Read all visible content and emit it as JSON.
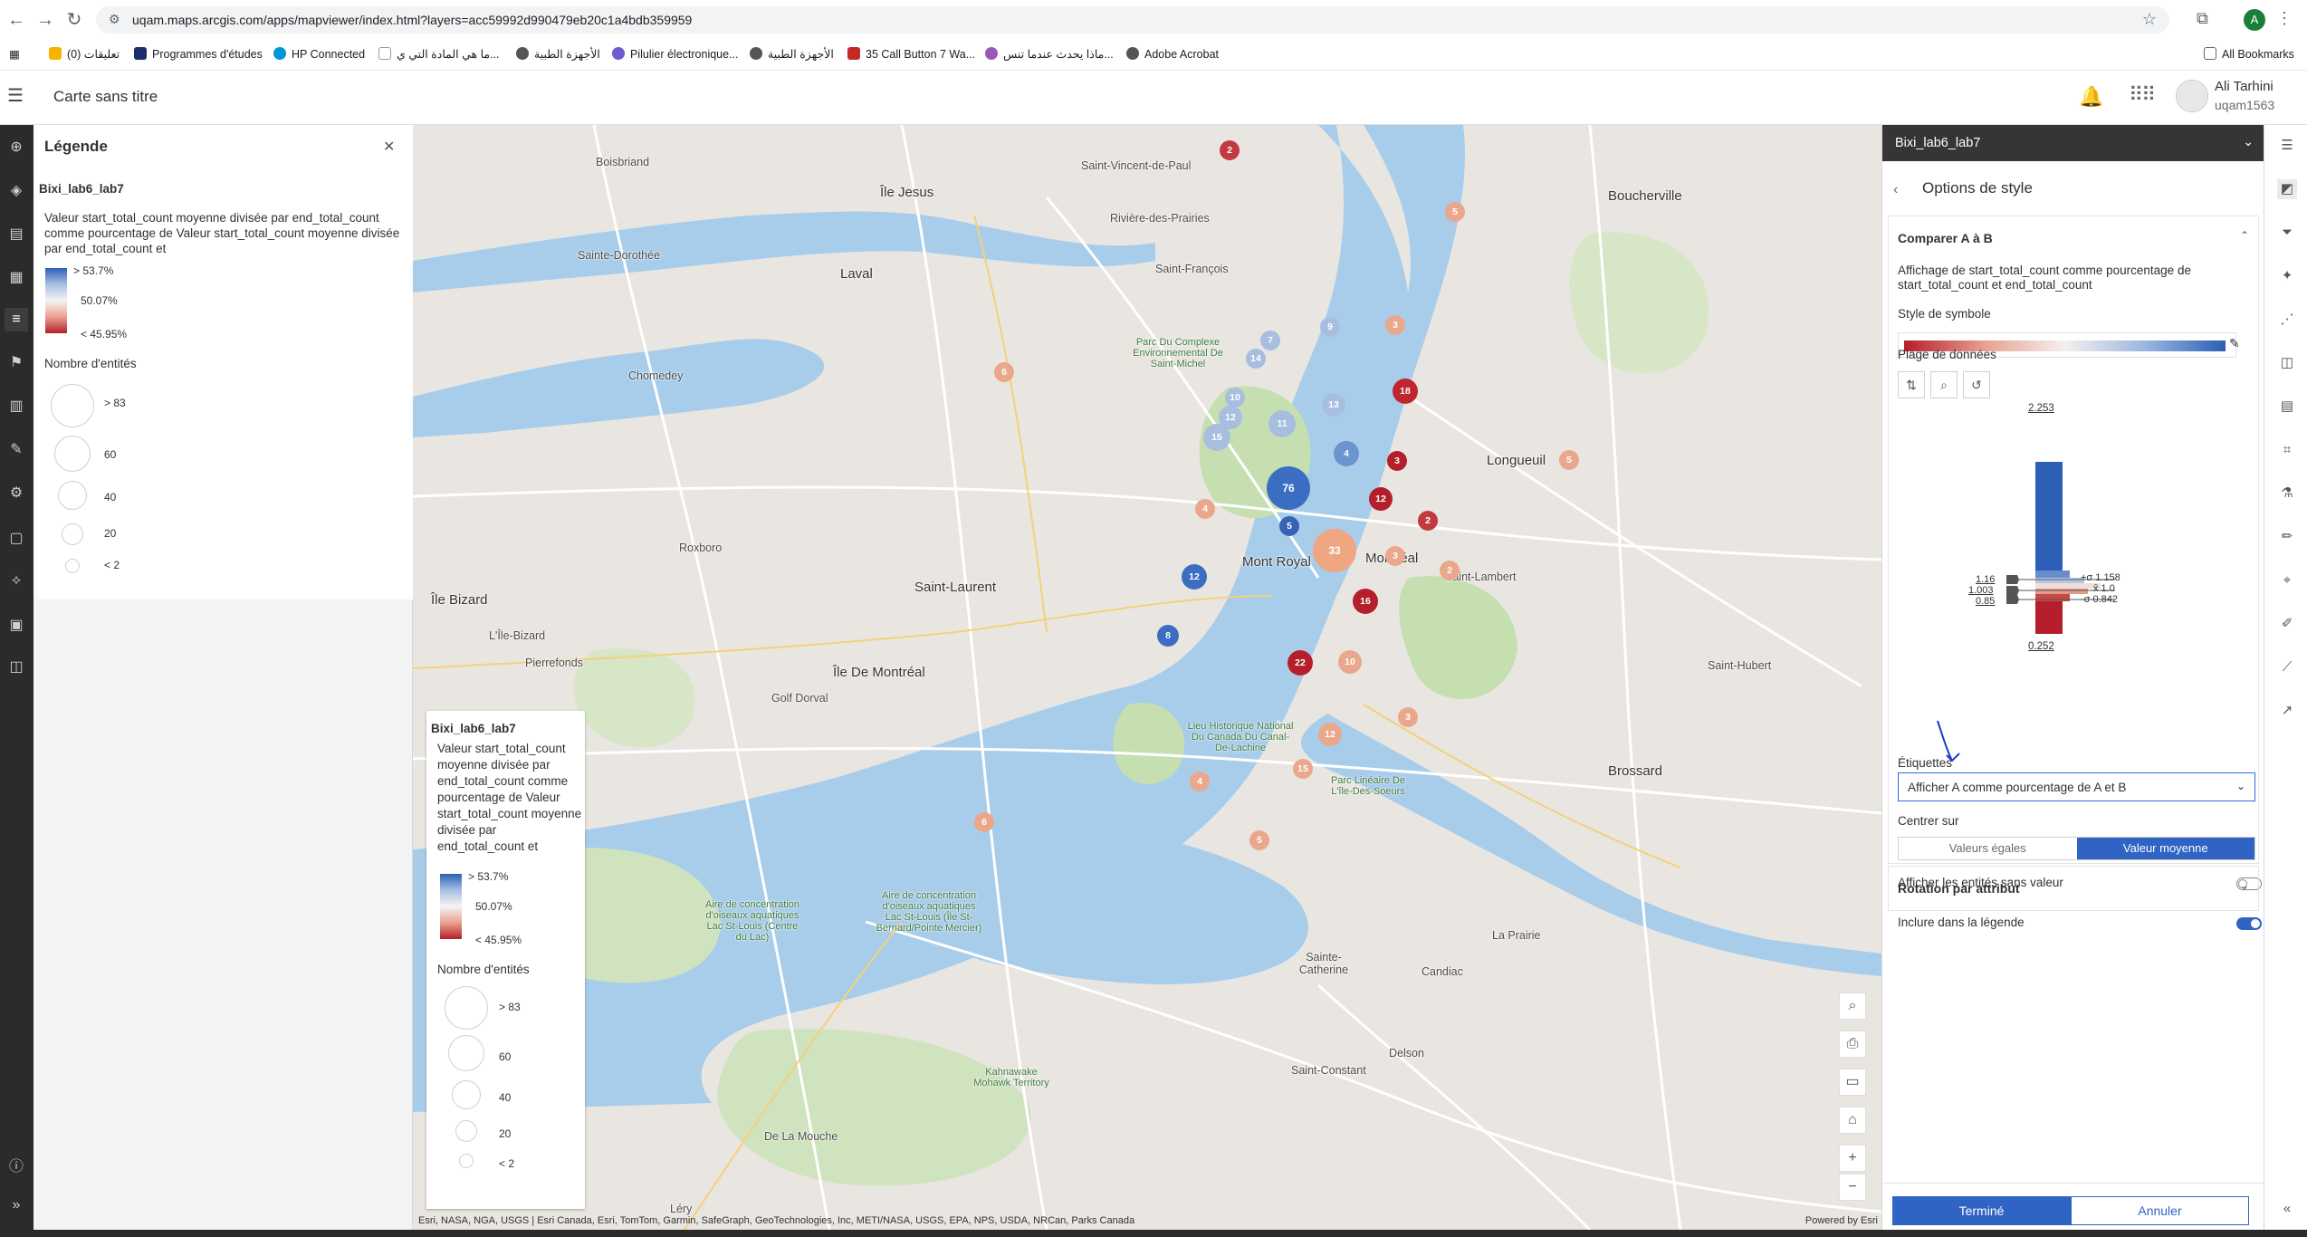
{
  "browser": {
    "url": "uqam.maps.arcgis.com/apps/mapviewer/index.html?layers=acc59992d990479eb20c1a4bdb359959",
    "profile_initial": "A",
    "bookmarks": [
      "تعليقات (0)",
      "Programmes d'études",
      "HP Connected",
      "ما هي المادة التي ي...",
      "الأجهزة الطبية",
      "Pilulier électronique...",
      "الأجهزة الطبية",
      "35 Call Button 7 Wa...",
      "ماذا يحدث عندما تنس...",
      "Adobe Acrobat"
    ],
    "all_bookmarks": "All Bookmarks"
  },
  "header": {
    "map_title": "Carte sans titre",
    "user_name": "Ali Tarhini",
    "user_id": "uqam1563"
  },
  "legend": {
    "title": "Légende",
    "layer_name": "Bixi_lab6_lab7",
    "description": "Valeur start_total_count moyenne divisée par end_total_count comme pourcentage de Valeur start_total_count moyenne divisée par end_total_count et",
    "ramp_labels": [
      "> 53.7%",
      "50.07%",
      "< 45.95%"
    ],
    "size_title": "Nombre d'entités",
    "size_labels": [
      "> 83",
      "60",
      "40",
      "20",
      "< 2"
    ]
  },
  "map": {
    "places": [
      "Boisbriand",
      "Île Jesus",
      "Laval",
      "Saint-Vincent-de-Paul",
      "Boucherville",
      "Sainte-Dorothée",
      "Saint-François",
      "Île Bizard",
      "Roxboro",
      "Saint-Laurent",
      "Pierrefonds",
      "L'Île-Bizard",
      "Longueuil",
      "Mont Royal",
      "Montréal",
      "Saint-Lambert",
      "Brossard",
      "La Prairie",
      "Candiac",
      "Delson",
      "Sainte-Catherine",
      "Saint-Constant",
      "Léry",
      "Chomedey",
      "Île De Montréal",
      "Golf Dorval",
      "Parc Du Complexe Environnemental De Saint-Michel",
      "Lieu Historique National Du Canada Du Canal-De-Lachine",
      "Parc Linéaire De L'île-Des-Soeurs",
      "Aire de concentration d'oiseaux aquatiques Lac St-Louis (Centre du Lac)",
      "Aire de concentration d'oiseaux aquatiques Lac St-Louis (Île St-Bernard/Pointe Mercier)",
      "Kahnawake Mohawk Territory",
      "De La Mouche",
      "Saint-Hubert",
      "Rivière-des-Prairies"
    ],
    "bubbles": [
      {
        "v": "2",
        "c": "red"
      },
      {
        "v": "5",
        "c": "lred"
      },
      {
        "v": "3",
        "c": "lred"
      },
      {
        "v": "12",
        "c": "blue"
      },
      {
        "v": "18",
        "c": "red"
      },
      {
        "v": "76",
        "c": "blue"
      },
      {
        "v": "4",
        "c": "lblue"
      },
      {
        "v": "5",
        "c": "blue"
      },
      {
        "v": "12",
        "c": "red"
      },
      {
        "v": "3",
        "c": "red"
      },
      {
        "v": "2",
        "c": "red"
      },
      {
        "v": "16",
        "c": "red"
      },
      {
        "v": "22",
        "c": "red"
      },
      {
        "v": "10",
        "c": "lred"
      },
      {
        "v": "12",
        "c": "blue"
      },
      {
        "v": "8",
        "c": "blue"
      },
      {
        "v": "33",
        "c": "lred"
      },
      {
        "v": "11",
        "c": "lblue"
      },
      {
        "v": "15",
        "c": "lblue"
      },
      {
        "v": "3",
        "c": "lred"
      },
      {
        "v": "4",
        "c": "lred"
      },
      {
        "v": "6",
        "c": "lred"
      },
      {
        "v": "13",
        "c": "lblue"
      },
      {
        "v": "10",
        "c": "lblue"
      },
      {
        "v": "14",
        "c": "lblue"
      },
      {
        "v": "9",
        "c": "lblue"
      },
      {
        "v": "15",
        "c": "lred"
      },
      {
        "v": "12",
        "c": "lred"
      },
      {
        "v": "5",
        "c": "lred"
      },
      {
        "v": "6",
        "c": "lred"
      },
      {
        "v": "3",
        "c": "lred"
      },
      {
        "v": "4",
        "c": "lred"
      },
      {
        "v": "2",
        "c": "lred"
      },
      {
        "v": "5",
        "c": "lred"
      },
      {
        "v": "7",
        "c": "lblue"
      }
    ],
    "attribution": "Esri, NASA, NGA, USGS | Esri Canada, Esri, TomTom, Garmin, SafeGraph, GeoTechnologies, Inc, METI/NASA, USGS, EPA, NPS, USDA, NRCan, Parks Canada",
    "powered_by": "Powered by Esri"
  },
  "style_panel": {
    "layer": "Bixi_lab6_lab7",
    "title": "Options de style",
    "section": "Comparer A à B",
    "display_text": "Affichage de start_total_count comme pourcentage de start_total_count et end_total_count",
    "symbol_style": "Style de symbole",
    "data_range": "Plage de données",
    "histogram": {
      "max": "2.253",
      "min": "0.252",
      "left_labels": [
        "1.16",
        "1.003",
        "0.85"
      ],
      "right_labels": [
        "+σ 1.158",
        "x̄ 1.0",
        "-σ 0.842"
      ]
    },
    "labels_title": "Étiquettes",
    "labels_value": "Afficher A comme pourcentage de A et B",
    "center_on": "Centrer sur",
    "center_options": [
      "Valeurs égales",
      "Valeur moyenne"
    ],
    "center_selected": "Valeur moyenne",
    "show_no_value": "Afficher les entités sans valeur",
    "show_no_value_on": false,
    "include_legend": "Inclure dans la légende",
    "include_legend_on": true,
    "rotation": "Rotation par attribut",
    "done": "Terminé",
    "cancel": "Annuler"
  },
  "colors": {
    "blue": "#2c5fb5",
    "red": "#b51e2b",
    "accent": "#2f63c4"
  }
}
